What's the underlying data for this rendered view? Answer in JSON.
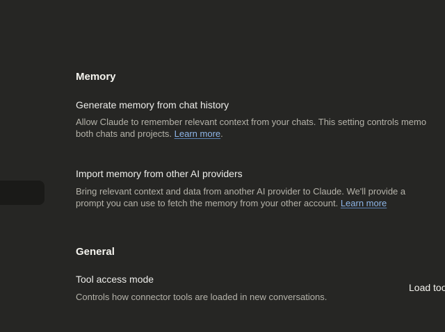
{
  "memory": {
    "heading": "Memory",
    "generate": {
      "title": "Generate memory from chat history",
      "desc_line1": "Allow Claude to remember relevant context from your chats. This setting controls memo",
      "desc_line2": "both chats and projects.",
      "link": "Learn more",
      "trailing": "."
    },
    "import": {
      "title": "Import memory from other AI providers",
      "desc_line1": "Bring relevant context and data from another AI provider to Claude. We'll provide a",
      "desc_line2": "prompt you can use to fetch the memory from your other account.",
      "link": "Learn more"
    }
  },
  "general": {
    "heading": "General",
    "tool_access": {
      "title": "Tool access mode",
      "desc": "Controls how connector tools are loaded in new conversations.",
      "control_value": "Load too"
    }
  }
}
